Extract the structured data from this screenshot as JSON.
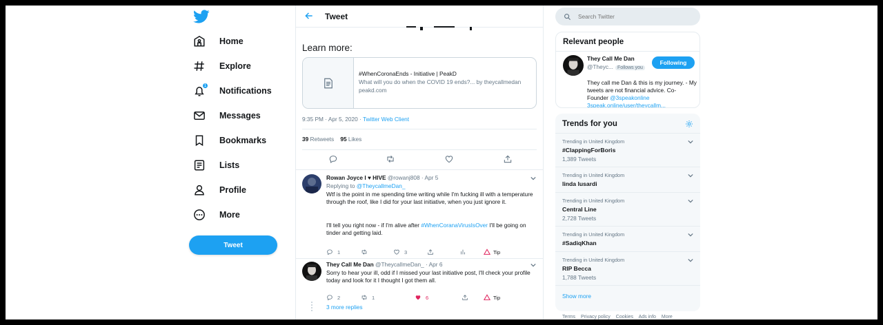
{
  "nav": {
    "logo": "twitter-bird-icon",
    "items": [
      {
        "label": "Home",
        "icon": "home-icon"
      },
      {
        "label": "Explore",
        "icon": "hashtag-icon"
      },
      {
        "label": "Notifications",
        "icon": "bell-icon",
        "badge": "1"
      },
      {
        "label": "Messages",
        "icon": "envelope-icon"
      },
      {
        "label": "Bookmarks",
        "icon": "bookmark-icon"
      },
      {
        "label": "Lists",
        "icon": "list-icon"
      },
      {
        "label": "Profile",
        "icon": "person-icon"
      },
      {
        "label": "More",
        "icon": "more-circle-icon"
      }
    ],
    "tweet_button": "Tweet"
  },
  "header": {
    "title": "Tweet"
  },
  "tweet": {
    "learn_more": "Learn more:",
    "card": {
      "title": "#WhenCoronaEnds - Initiative | PeakD",
      "description": "What will you do when the COVID 19 ends?... by theycallmedan",
      "domain": "peakd.com"
    },
    "time": "9:35 PM · Apr 5, 2020 · ",
    "client": "Twitter Web Client",
    "retweets_count": "39",
    "retweets_label": "Retweets",
    "likes_count": "95",
    "likes_label": "Likes"
  },
  "replies": [
    {
      "name": "Rowan Joyce I ♥ HIVE",
      "handle": "@rowanj808 · Apr 5",
      "replying_label": "Replying to ",
      "replying_to": "@TheycallmeDan_",
      "text1": "Wtf is the point in me spending time writing while I'm fucking ill with a temperature through the roof, like I did for your last initiative, when you just ignore it.",
      "text2a": "I'll tell you right now - if I'm alive after ",
      "text2tag": "#WhenCoranaVirusIsOver",
      "text2b": " I'll be going on tinder and getting laid.",
      "reply_count": "1",
      "retweet_count": "",
      "like_count": "3",
      "tip": "Tip"
    },
    {
      "name": "They Call Me Dan",
      "handle": "@TheycallmeDan_ · Apr 6",
      "text1": "Sorry to hear your ill, odd if I missed your last initiative post, I'll check your profile today and look for it I thought I got them all.",
      "reply_count": "2",
      "retweet_count": "1",
      "like_count": "6",
      "tip": "Tip"
    }
  ],
  "more_replies": "3 more replies",
  "search": {
    "placeholder": "Search Twitter"
  },
  "relevant": {
    "title": "Relevant people",
    "name": "They Call Me Dan",
    "handle": "@Theyc...",
    "follows_you": "Follows you",
    "button": "Following",
    "bio1": "They call me Dan & this is my journey. - My tweets are not financial advice. Co-Founder ",
    "bio_link": "@3speakonline",
    "bio_url": "3speak.online/user/theycallm..."
  },
  "trends": {
    "title": "Trends for you",
    "items": [
      {
        "context": "Trending in United Kingdom",
        "name": "#ClappingForBoris",
        "count": "1,389 Tweets"
      },
      {
        "context": "Trending in United Kingdom",
        "name": "linda lusardi",
        "count": ""
      },
      {
        "context": "Trending in United Kingdom",
        "name": "Central Line",
        "count": "2,728 Tweets"
      },
      {
        "context": "Trending in United Kingdom",
        "name": "#SadiqKhan",
        "count": ""
      },
      {
        "context": "Trending in United Kingdom",
        "name": "RIP Becca",
        "count": "1,788 Tweets"
      }
    ],
    "show_more": "Show more"
  },
  "footer": [
    "Terms",
    "Privacy policy",
    "Cookies",
    "Ads info",
    "More"
  ],
  "colors": {
    "accent": "#1da1f2",
    "text": "#14171a",
    "muted": "#657786",
    "like": "#e0245e",
    "tip": "#e0245e"
  }
}
